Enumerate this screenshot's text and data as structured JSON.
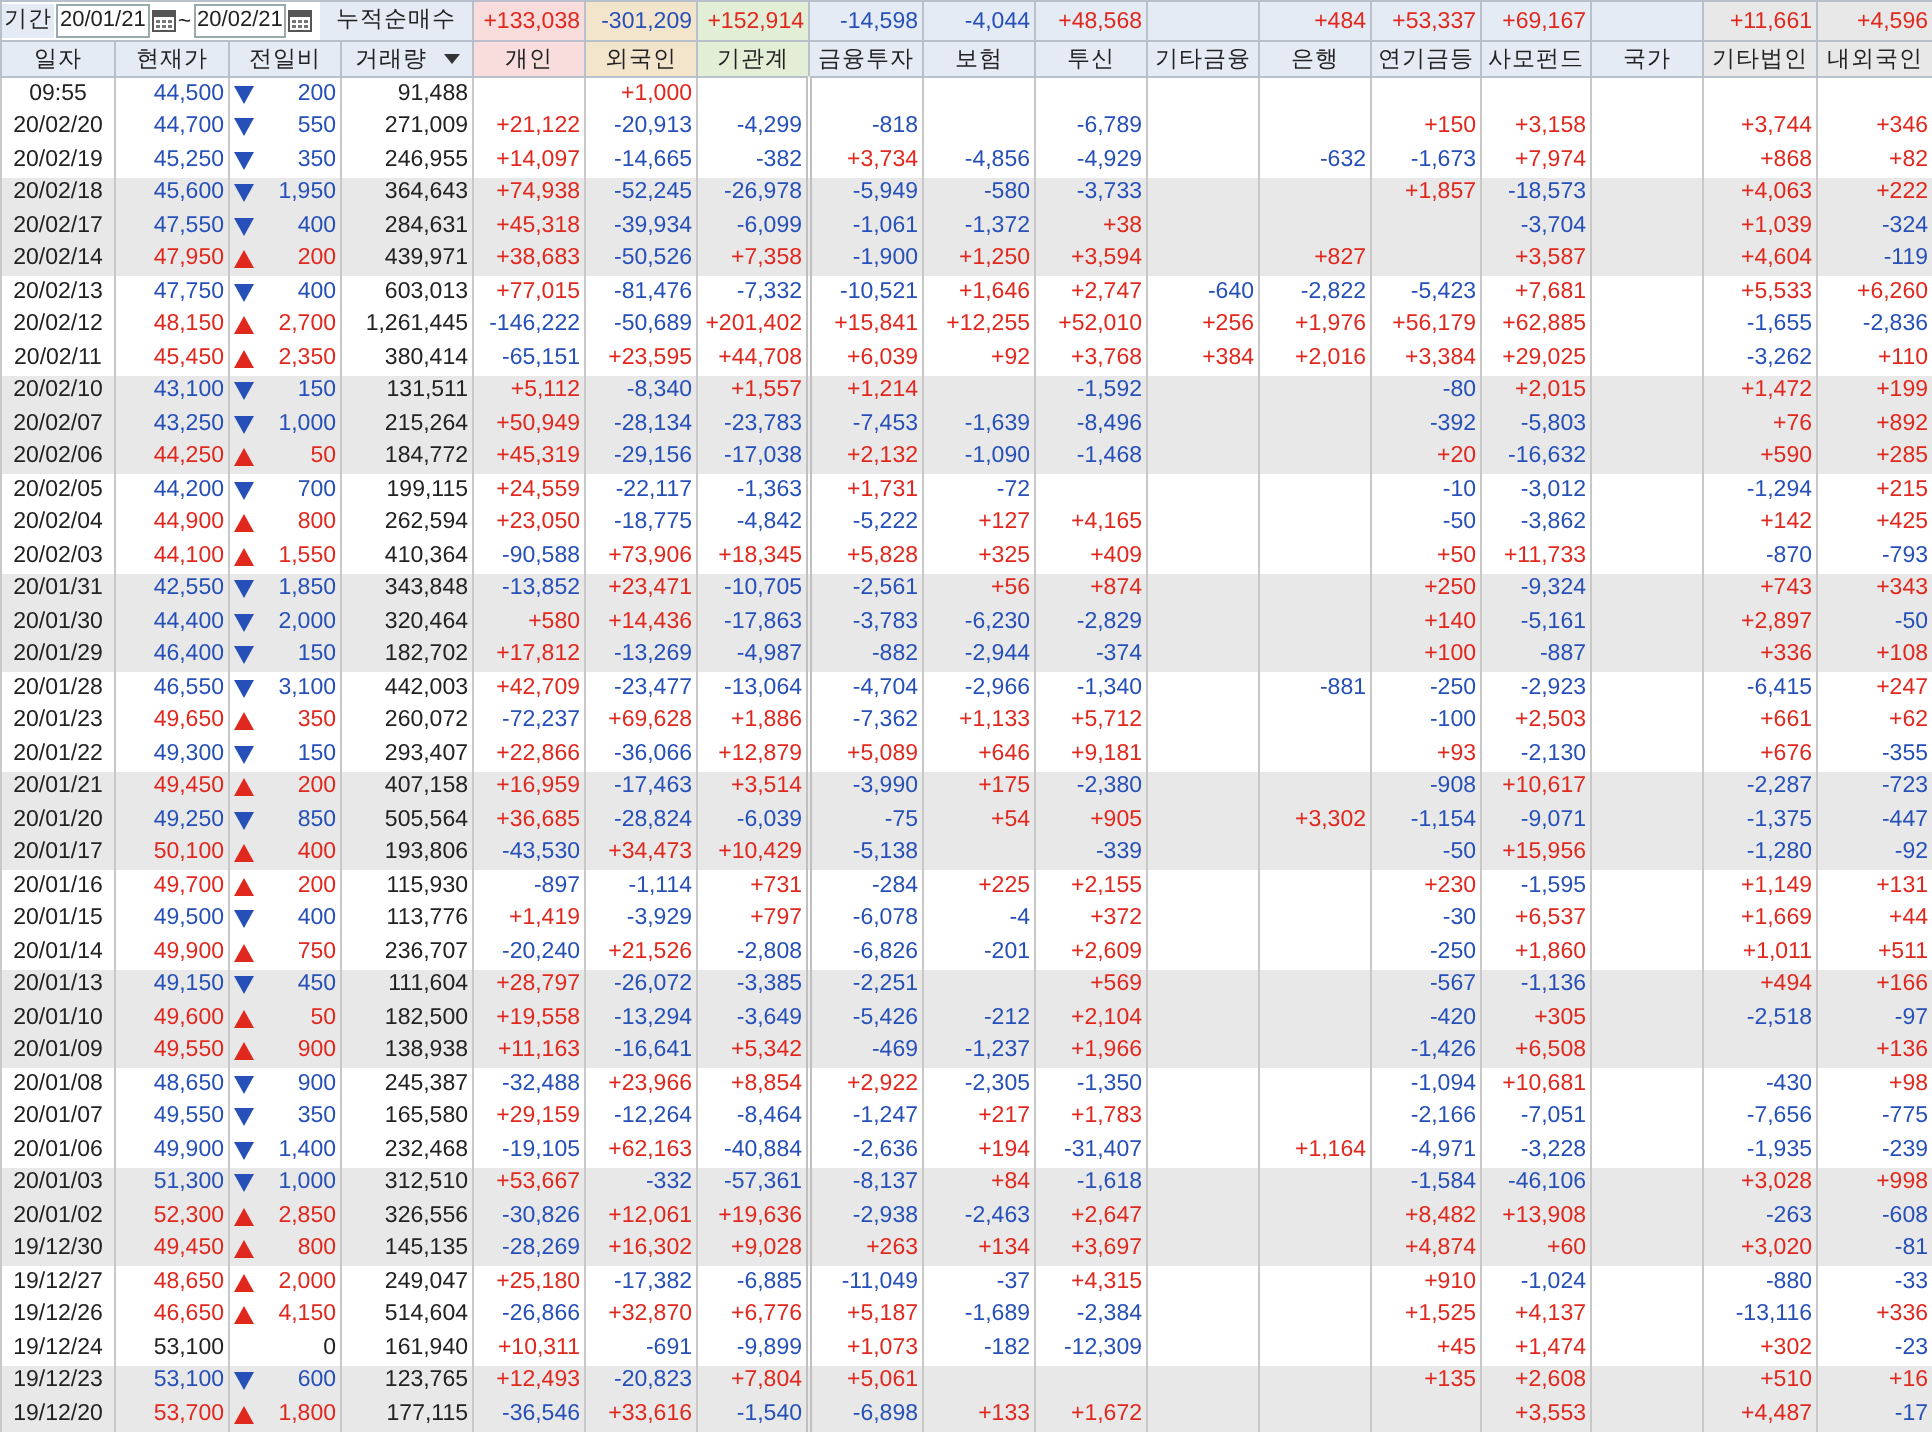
{
  "filter": {
    "label": "기간",
    "from": "20/01/21",
    "to": "20/02/21",
    "separator": "~",
    "summary_label": "누적순매수"
  },
  "summary": {
    "individual": "+133,038",
    "foreign": "-301,209",
    "institution_total": "+152,914",
    "financial_investment": "-14,598",
    "insurance": "-4,044",
    "investment_trust": "+48,568",
    "bank": "+484",
    "pension": "+53,337",
    "private_fund": "+69,167",
    "other_corp": "+11,661",
    "other_foreigner": "+4,596"
  },
  "columns": [
    {
      "label": "일자",
      "color": "#e4ebf4"
    },
    {
      "label": "현재가",
      "color": "#e4ebf4"
    },
    {
      "label": "전일비",
      "color": "#e4ebf4"
    },
    {
      "label": "거래량",
      "color": "#e4ebf4"
    },
    {
      "label": "개인",
      "color": "#f9dcdc"
    },
    {
      "label": "외국인",
      "color": "#f3e4cc"
    },
    {
      "label": "기관계",
      "color": "#e3eed6"
    },
    {
      "label": "금융투자",
      "color": "#e4ebf4"
    },
    {
      "label": "보험",
      "color": "#e4ebf4"
    },
    {
      "label": "투신",
      "color": "#e4ebf4"
    },
    {
      "label": "기타금융",
      "color": "#e4ebf4"
    },
    {
      "label": "은행",
      "color": "#e4ebf4"
    },
    {
      "label": "연기금등",
      "color": "#e4ebf4"
    },
    {
      "label": "사모펀드",
      "color": "#e4ebf4"
    },
    {
      "label": "국가",
      "color": "#e4ebf4"
    },
    {
      "label": "기타법인",
      "color": "#e8e8e8"
    },
    {
      "label": "내외국인",
      "color": "#e8e8e8"
    }
  ],
  "rows": [
    {
      "date": "09:55",
      "price": "44,500",
      "kind": "down",
      "change": "200",
      "volume": "91,488",
      "values": {
        "foreign": "+1,000"
      }
    },
    {
      "date": "20/02/20",
      "price": "44,700",
      "kind": "down",
      "change": "550",
      "volume": "271,009",
      "values": {
        "individual": "+21,122",
        "foreign": "-20,913",
        "institution_total": "-4,299",
        "financial_investment": "-818",
        "investment_trust": "-6,789",
        "pension": "+150",
        "private_fund": "+3,158",
        "other_corp": "+3,744",
        "other_foreigner": "+346"
      }
    },
    {
      "date": "20/02/19",
      "price": "45,250",
      "kind": "down",
      "change": "350",
      "volume": "246,955",
      "values": {
        "individual": "+14,097",
        "foreign": "-14,665",
        "institution_total": "-382",
        "financial_investment": "+3,734",
        "insurance": "-4,856",
        "investment_trust": "-4,929",
        "bank": "-632",
        "pension": "-1,673",
        "private_fund": "+7,974",
        "other_corp": "+868",
        "other_foreigner": "+82"
      }
    },
    {
      "date": "20/02/18",
      "price": "45,600",
      "kind": "down",
      "change": "1,950",
      "volume": "364,643",
      "values": {
        "individual": "+74,938",
        "foreign": "-52,245",
        "institution_total": "-26,978",
        "financial_investment": "-5,949",
        "insurance": "-580",
        "investment_trust": "-3,733",
        "pension": "+1,857",
        "private_fund": "-18,573",
        "other_corp": "+4,063",
        "other_foreigner": "+222"
      }
    },
    {
      "date": "20/02/17",
      "price": "47,550",
      "kind": "down",
      "change": "400",
      "volume": "284,631",
      "values": {
        "individual": "+45,318",
        "foreign": "-39,934",
        "institution_total": "-6,099",
        "financial_investment": "-1,061",
        "insurance": "-1,372",
        "investment_trust": "+38",
        "private_fund": "-3,704",
        "other_corp": "+1,039",
        "other_foreigner": "-324"
      }
    },
    {
      "date": "20/02/14",
      "price": "47,950",
      "kind": "up",
      "change": "200",
      "volume": "439,971",
      "values": {
        "individual": "+38,683",
        "foreign": "-50,526",
        "institution_total": "+7,358",
        "financial_investment": "-1,900",
        "insurance": "+1,250",
        "investment_trust": "+3,594",
        "bank": "+827",
        "private_fund": "+3,587",
        "other_corp": "+4,604",
        "other_foreigner": "-119"
      }
    },
    {
      "date": "20/02/13",
      "price": "47,750",
      "kind": "down",
      "change": "400",
      "volume": "603,013",
      "values": {
        "individual": "+77,015",
        "foreign": "-81,476",
        "institution_total": "-7,332",
        "financial_investment": "-10,521",
        "insurance": "+1,646",
        "investment_trust": "+2,747",
        "other_finance": "-640",
        "bank": "-2,822",
        "pension": "-5,423",
        "private_fund": "+7,681",
        "other_corp": "+5,533",
        "other_foreigner": "+6,260"
      }
    },
    {
      "date": "20/02/12",
      "price": "48,150",
      "kind": "up",
      "change": "2,700",
      "volume": "1,261,445",
      "values": {
        "individual": "-146,222",
        "foreign": "-50,689",
        "institution_total": "+201,402",
        "financial_investment": "+15,841",
        "insurance": "+12,255",
        "investment_trust": "+52,010",
        "other_finance": "+256",
        "bank": "+1,976",
        "pension": "+56,179",
        "private_fund": "+62,885",
        "other_corp": "-1,655",
        "other_foreigner": "-2,836"
      }
    },
    {
      "date": "20/02/11",
      "price": "45,450",
      "kind": "up",
      "change": "2,350",
      "volume": "380,414",
      "values": {
        "individual": "-65,151",
        "foreign": "+23,595",
        "institution_total": "+44,708",
        "financial_investment": "+6,039",
        "insurance": "+92",
        "investment_trust": "+3,768",
        "other_finance": "+384",
        "bank": "+2,016",
        "pension": "+3,384",
        "private_fund": "+29,025",
        "other_corp": "-3,262",
        "other_foreigner": "+110"
      }
    },
    {
      "date": "20/02/10",
      "price": "43,100",
      "kind": "down",
      "change": "150",
      "volume": "131,511",
      "values": {
        "individual": "+5,112",
        "foreign": "-8,340",
        "institution_total": "+1,557",
        "financial_investment": "+1,214",
        "investment_trust": "-1,592",
        "pension": "-80",
        "private_fund": "+2,015",
        "other_corp": "+1,472",
        "other_foreigner": "+199"
      }
    },
    {
      "date": "20/02/07",
      "price": "43,250",
      "kind": "down",
      "change": "1,000",
      "volume": "215,264",
      "values": {
        "individual": "+50,949",
        "foreign": "-28,134",
        "institution_total": "-23,783",
        "financial_investment": "-7,453",
        "insurance": "-1,639",
        "investment_trust": "-8,496",
        "pension": "-392",
        "private_fund": "-5,803",
        "other_corp": "+76",
        "other_foreigner": "+892"
      }
    },
    {
      "date": "20/02/06",
      "price": "44,250",
      "kind": "up",
      "change": "50",
      "volume": "184,772",
      "values": {
        "individual": "+45,319",
        "foreign": "-29,156",
        "institution_total": "-17,038",
        "financial_investment": "+2,132",
        "insurance": "-1,090",
        "investment_trust": "-1,468",
        "pension": "+20",
        "private_fund": "-16,632",
        "other_corp": "+590",
        "other_foreigner": "+285"
      }
    },
    {
      "date": "20/02/05",
      "price": "44,200",
      "kind": "down",
      "change": "700",
      "volume": "199,115",
      "values": {
        "individual": "+24,559",
        "foreign": "-22,117",
        "institution_total": "-1,363",
        "financial_investment": "+1,731",
        "insurance": "-72",
        "pension": "-10",
        "private_fund": "-3,012",
        "other_corp": "-1,294",
        "other_foreigner": "+215"
      }
    },
    {
      "date": "20/02/04",
      "price": "44,900",
      "kind": "up",
      "change": "800",
      "volume": "262,594",
      "values": {
        "individual": "+23,050",
        "foreign": "-18,775",
        "institution_total": "-4,842",
        "financial_investment": "-5,222",
        "insurance": "+127",
        "investment_trust": "+4,165",
        "pension": "-50",
        "private_fund": "-3,862",
        "other_corp": "+142",
        "other_foreigner": "+425"
      }
    },
    {
      "date": "20/02/03",
      "price": "44,100",
      "kind": "up",
      "change": "1,550",
      "volume": "410,364",
      "values": {
        "individual": "-90,588",
        "foreign": "+73,906",
        "institution_total": "+18,345",
        "financial_investment": "+5,828",
        "insurance": "+325",
        "investment_trust": "+409",
        "pension": "+50",
        "private_fund": "+11,733",
        "other_corp": "-870",
        "other_foreigner": "-793"
      }
    },
    {
      "date": "20/01/31",
      "price": "42,550",
      "kind": "down",
      "change": "1,850",
      "volume": "343,848",
      "values": {
        "individual": "-13,852",
        "foreign": "+23,471",
        "institution_total": "-10,705",
        "financial_investment": "-2,561",
        "insurance": "+56",
        "investment_trust": "+874",
        "pension": "+250",
        "private_fund": "-9,324",
        "other_corp": "+743",
        "other_foreigner": "+343"
      }
    },
    {
      "date": "20/01/30",
      "price": "44,400",
      "kind": "down",
      "change": "2,000",
      "volume": "320,464",
      "values": {
        "individual": "+580",
        "foreign": "+14,436",
        "institution_total": "-17,863",
        "financial_investment": "-3,783",
        "insurance": "-6,230",
        "investment_trust": "-2,829",
        "pension": "+140",
        "private_fund": "-5,161",
        "other_corp": "+2,897",
        "other_foreigner": "-50"
      }
    },
    {
      "date": "20/01/29",
      "price": "46,400",
      "kind": "down",
      "change": "150",
      "volume": "182,702",
      "values": {
        "individual": "+17,812",
        "foreign": "-13,269",
        "institution_total": "-4,987",
        "financial_investment": "-882",
        "insurance": "-2,944",
        "investment_trust": "-374",
        "pension": "+100",
        "private_fund": "-887",
        "other_corp": "+336",
        "other_foreigner": "+108"
      }
    },
    {
      "date": "20/01/28",
      "price": "46,550",
      "kind": "down",
      "change": "3,100",
      "volume": "442,003",
      "values": {
        "individual": "+42,709",
        "foreign": "-23,477",
        "institution_total": "-13,064",
        "financial_investment": "-4,704",
        "insurance": "-2,966",
        "investment_trust": "-1,340",
        "bank": "-881",
        "pension": "-250",
        "private_fund": "-2,923",
        "other_corp": "-6,415",
        "other_foreigner": "+247"
      }
    },
    {
      "date": "20/01/23",
      "price": "49,650",
      "kind": "up",
      "change": "350",
      "volume": "260,072",
      "values": {
        "individual": "-72,237",
        "foreign": "+69,628",
        "institution_total": "+1,886",
        "financial_investment": "-7,362",
        "insurance": "+1,133",
        "investment_trust": "+5,712",
        "pension": "-100",
        "private_fund": "+2,503",
        "other_corp": "+661",
        "other_foreigner": "+62"
      }
    },
    {
      "date": "20/01/22",
      "price": "49,300",
      "kind": "down",
      "change": "150",
      "volume": "293,407",
      "values": {
        "individual": "+22,866",
        "foreign": "-36,066",
        "institution_total": "+12,879",
        "financial_investment": "+5,089",
        "insurance": "+646",
        "investment_trust": "+9,181",
        "pension": "+93",
        "private_fund": "-2,130",
        "other_corp": "+676",
        "other_foreigner": "-355"
      }
    },
    {
      "date": "20/01/21",
      "price": "49,450",
      "kind": "up",
      "change": "200",
      "volume": "407,158",
      "values": {
        "individual": "+16,959",
        "foreign": "-17,463",
        "institution_total": "+3,514",
        "financial_investment": "-3,990",
        "insurance": "+175",
        "investment_trust": "-2,380",
        "pension": "-908",
        "private_fund": "+10,617",
        "other_corp": "-2,287",
        "other_foreigner": "-723"
      }
    },
    {
      "date": "20/01/20",
      "price": "49,250",
      "kind": "down",
      "change": "850",
      "volume": "505,564",
      "values": {
        "individual": "+36,685",
        "foreign": "-28,824",
        "institution_total": "-6,039",
        "financial_investment": "-75",
        "insurance": "+54",
        "investment_trust": "+905",
        "bank": "+3,302",
        "pension": "-1,154",
        "private_fund": "-9,071",
        "other_corp": "-1,375",
        "other_foreigner": "-447"
      }
    },
    {
      "date": "20/01/17",
      "price": "50,100",
      "kind": "up",
      "change": "400",
      "volume": "193,806",
      "values": {
        "individual": "-43,530",
        "foreign": "+34,473",
        "institution_total": "+10,429",
        "financial_investment": "-5,138",
        "investment_trust": "-339",
        "pension": "-50",
        "private_fund": "+15,956",
        "other_corp": "-1,280",
        "other_foreigner": "-92"
      }
    },
    {
      "date": "20/01/16",
      "price": "49,700",
      "kind": "up",
      "change": "200",
      "volume": "115,930",
      "values": {
        "individual": "-897",
        "foreign": "-1,114",
        "institution_total": "+731",
        "financial_investment": "-284",
        "insurance": "+225",
        "investment_trust": "+2,155",
        "pension": "+230",
        "private_fund": "-1,595",
        "other_corp": "+1,149",
        "other_foreigner": "+131"
      }
    },
    {
      "date": "20/01/15",
      "price": "49,500",
      "kind": "down",
      "change": "400",
      "volume": "113,776",
      "values": {
        "individual": "+1,419",
        "foreign": "-3,929",
        "institution_total": "+797",
        "financial_investment": "-6,078",
        "insurance": "-4",
        "investment_trust": "+372",
        "pension": "-30",
        "private_fund": "+6,537",
        "other_corp": "+1,669",
        "other_foreigner": "+44"
      }
    },
    {
      "date": "20/01/14",
      "price": "49,900",
      "kind": "up",
      "change": "750",
      "volume": "236,707",
      "values": {
        "individual": "-20,240",
        "foreign": "+21,526",
        "institution_total": "-2,808",
        "financial_investment": "-6,826",
        "insurance": "-201",
        "investment_trust": "+2,609",
        "pension": "-250",
        "private_fund": "+1,860",
        "other_corp": "+1,011",
        "other_foreigner": "+511"
      }
    },
    {
      "date": "20/01/13",
      "price": "49,150",
      "kind": "down",
      "change": "450",
      "volume": "111,604",
      "values": {
        "individual": "+28,797",
        "foreign": "-26,072",
        "institution_total": "-3,385",
        "financial_investment": "-2,251",
        "investment_trust": "+569",
        "pension": "-567",
        "private_fund": "-1,136",
        "other_corp": "+494",
        "other_foreigner": "+166"
      }
    },
    {
      "date": "20/01/10",
      "price": "49,600",
      "kind": "up",
      "change": "50",
      "volume": "182,500",
      "values": {
        "individual": "+19,558",
        "foreign": "-13,294",
        "institution_total": "-3,649",
        "financial_investment": "-5,426",
        "insurance": "-212",
        "investment_trust": "+2,104",
        "pension": "-420",
        "private_fund": "+305",
        "other_corp": "-2,518",
        "other_foreigner": "-97"
      }
    },
    {
      "date": "20/01/09",
      "price": "49,550",
      "kind": "up",
      "change": "900",
      "volume": "138,938",
      "values": {
        "individual": "+11,163",
        "foreign": "-16,641",
        "institution_total": "+5,342",
        "financial_investment": "-469",
        "insurance": "-1,237",
        "investment_trust": "+1,966",
        "pension": "-1,426",
        "private_fund": "+6,508",
        "other_foreigner": "+136"
      }
    },
    {
      "date": "20/01/08",
      "price": "48,650",
      "kind": "down",
      "change": "900",
      "volume": "245,387",
      "values": {
        "individual": "-32,488",
        "foreign": "+23,966",
        "institution_total": "+8,854",
        "financial_investment": "+2,922",
        "insurance": "-2,305",
        "investment_trust": "-1,350",
        "pension": "-1,094",
        "private_fund": "+10,681",
        "other_corp": "-430",
        "other_foreigner": "+98"
      }
    },
    {
      "date": "20/01/07",
      "price": "49,550",
      "kind": "down",
      "change": "350",
      "volume": "165,580",
      "values": {
        "individual": "+29,159",
        "foreign": "-12,264",
        "institution_total": "-8,464",
        "financial_investment": "-1,247",
        "insurance": "+217",
        "investment_trust": "+1,783",
        "pension": "-2,166",
        "private_fund": "-7,051",
        "other_corp": "-7,656",
        "other_foreigner": "-775"
      }
    },
    {
      "date": "20/01/06",
      "price": "49,900",
      "kind": "down",
      "change": "1,400",
      "volume": "232,468",
      "values": {
        "individual": "-19,105",
        "foreign": "+62,163",
        "institution_total": "-40,884",
        "financial_investment": "-2,636",
        "insurance": "+194",
        "investment_trust": "-31,407",
        "bank": "+1,164",
        "pension": "-4,971",
        "private_fund": "-3,228",
        "other_corp": "-1,935",
        "other_foreigner": "-239"
      }
    },
    {
      "date": "20/01/03",
      "price": "51,300",
      "kind": "down",
      "change": "1,000",
      "volume": "312,510",
      "values": {
        "individual": "+53,667",
        "foreign": "-332",
        "institution_total": "-57,361",
        "financial_investment": "-8,137",
        "insurance": "+84",
        "investment_trust": "-1,618",
        "pension": "-1,584",
        "private_fund": "-46,106",
        "other_corp": "+3,028",
        "other_foreigner": "+998"
      }
    },
    {
      "date": "20/01/02",
      "price": "52,300",
      "kind": "up",
      "change": "2,850",
      "volume": "326,556",
      "values": {
        "individual": "-30,826",
        "foreign": "+12,061",
        "institution_total": "+19,636",
        "financial_investment": "-2,938",
        "insurance": "-2,463",
        "investment_trust": "+2,647",
        "pension": "+8,482",
        "private_fund": "+13,908",
        "other_corp": "-263",
        "other_foreigner": "-608"
      }
    },
    {
      "date": "19/12/30",
      "price": "49,450",
      "kind": "up",
      "change": "800",
      "volume": "145,135",
      "values": {
        "individual": "-28,269",
        "foreign": "+16,302",
        "institution_total": "+9,028",
        "financial_investment": "+263",
        "insurance": "+134",
        "investment_trust": "+3,697",
        "pension": "+4,874",
        "private_fund": "+60",
        "other_corp": "+3,020",
        "other_foreigner": "-81"
      }
    },
    {
      "date": "19/12/27",
      "price": "48,650",
      "kind": "up",
      "change": "2,000",
      "volume": "249,047",
      "values": {
        "individual": "+25,180",
        "foreign": "-17,382",
        "institution_total": "-6,885",
        "financial_investment": "-11,049",
        "insurance": "-37",
        "investment_trust": "+4,315",
        "pension": "+910",
        "private_fund": "-1,024",
        "other_corp": "-880",
        "other_foreigner": "-33"
      }
    },
    {
      "date": "19/12/26",
      "price": "46,650",
      "kind": "up",
      "change": "4,150",
      "volume": "514,604",
      "values": {
        "individual": "-26,866",
        "foreign": "+32,870",
        "institution_total": "+6,776",
        "financial_investment": "+5,187",
        "insurance": "-1,689",
        "investment_trust": "-2,384",
        "pension": "+1,525",
        "private_fund": "+4,137",
        "other_corp": "-13,116",
        "other_foreigner": "+336"
      }
    },
    {
      "date": "19/12/24",
      "price": "53,100",
      "kind": "flat",
      "change": "0",
      "volume": "161,940",
      "values": {
        "individual": "+10,311",
        "foreign": "-691",
        "institution_total": "-9,899",
        "financial_investment": "+1,073",
        "insurance": "-182",
        "investment_trust": "-12,309",
        "pension": "+45",
        "private_fund": "+1,474",
        "other_corp": "+302",
        "other_foreigner": "-23"
      }
    },
    {
      "date": "19/12/23",
      "price": "53,100",
      "kind": "down",
      "change": "600",
      "volume": "123,765",
      "values": {
        "individual": "+12,493",
        "foreign": "-20,823",
        "institution_total": "+7,804",
        "financial_investment": "+5,061",
        "pension": "+135",
        "private_fund": "+2,608",
        "other_corp": "+510",
        "other_foreigner": "+16"
      }
    },
    {
      "date": "19/12/20",
      "price": "53,700",
      "kind": "up",
      "change": "1,800",
      "volume": "177,115",
      "values": {
        "individual": "-36,546",
        "foreign": "+33,616",
        "institution_total": "-1,540",
        "financial_investment": "-6,898",
        "insurance": "+133",
        "investment_trust": "+1,672",
        "private_fund": "+3,553",
        "other_corp": "+4,487",
        "other_foreigner": "-17"
      }
    }
  ]
}
